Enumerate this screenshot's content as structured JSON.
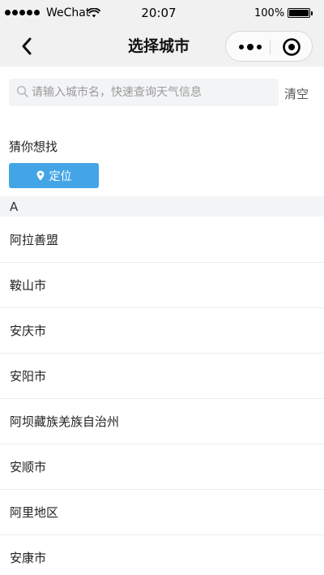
{
  "status_bar": {
    "carrier": "WeChat",
    "time": "20:07",
    "battery": "100%",
    "battery_level": 1.0,
    "wifi_icon": "wifi-icon",
    "signal_icon": "signal-dots-icon",
    "battery_icon": "battery-icon"
  },
  "nav": {
    "title": "选择城市",
    "back_icon": "chevron-left-icon",
    "more_icon": "more-dots-icon",
    "close_icon": "target-circle-icon"
  },
  "search": {
    "placeholder": "请输入城市名，快速查询天气信息",
    "value": "",
    "icon": "search-icon",
    "clear_label": "清空"
  },
  "guess": {
    "title": "猜你想找",
    "locate_label": "定位",
    "locate_icon": "map-pin-icon"
  },
  "index": {
    "letter": "A"
  },
  "cities": [
    "阿拉善盟",
    "鞍山市",
    "安庆市",
    "安阳市",
    "阿坝藏族羌族自治州",
    "安顺市",
    "阿里地区",
    "安康市"
  ],
  "colors": {
    "header_bg": "#f1f1f1",
    "accent": "#43a5e6",
    "search_bg": "#f3f4f6",
    "divider": "#ececec"
  }
}
